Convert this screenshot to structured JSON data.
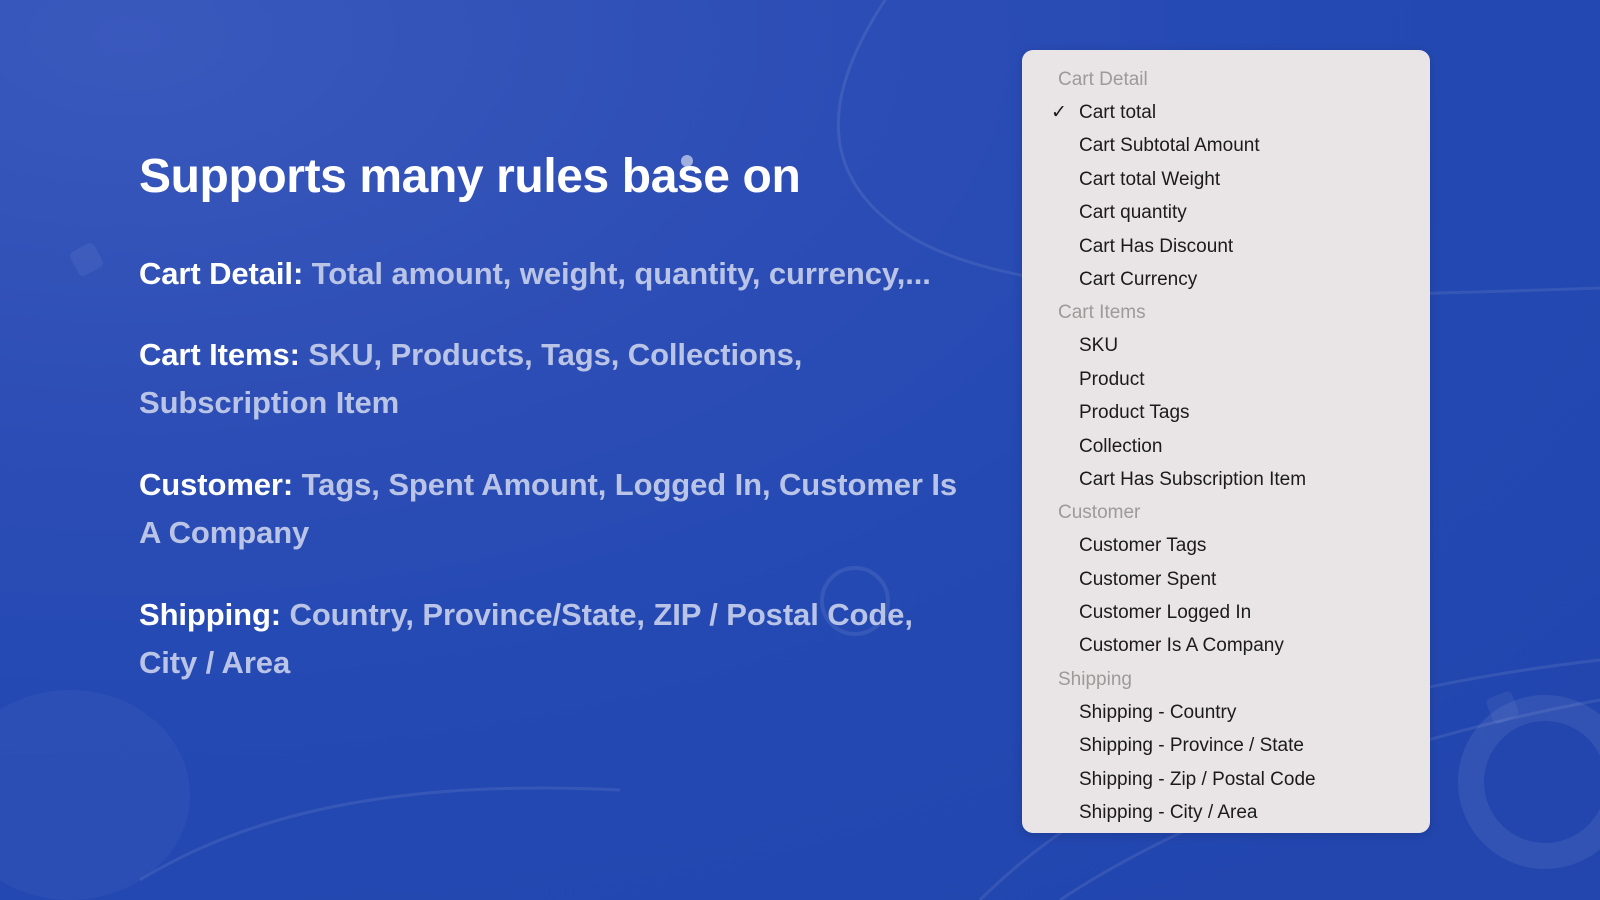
{
  "slide": {
    "headline": "Supports many rules base on",
    "paragraphs": [
      {
        "label": "Cart Detail:",
        "detail": " Total amount, weight, quantity, currency,..."
      },
      {
        "label": "Cart Items:",
        "detail": " SKU, Products, Tags, Collections, Subscription Item"
      },
      {
        "label": "Customer:",
        "detail": " Tags, Spent Amount, Logged In, Customer Is A Company"
      },
      {
        "label": "Shipping:",
        "detail": " Country, Province/State, ZIP / Postal Code, City / Area"
      }
    ]
  },
  "dropdown": {
    "selected_value": "Cart total",
    "check_glyph": "✓",
    "groups": [
      {
        "label": "Cart Detail",
        "options": [
          {
            "label": "Cart total",
            "selected": true
          },
          {
            "label": "Cart Subtotal Amount",
            "selected": false
          },
          {
            "label": "Cart total Weight",
            "selected": false
          },
          {
            "label": "Cart quantity",
            "selected": false
          },
          {
            "label": "Cart Has Discount",
            "selected": false
          },
          {
            "label": "Cart Currency",
            "selected": false
          }
        ]
      },
      {
        "label": "Cart Items",
        "options": [
          {
            "label": "SKU",
            "selected": false
          },
          {
            "label": "Product",
            "selected": false
          },
          {
            "label": "Product Tags",
            "selected": false
          },
          {
            "label": "Collection",
            "selected": false
          },
          {
            "label": "Cart Has Subscription Item",
            "selected": false
          }
        ]
      },
      {
        "label": "Customer",
        "options": [
          {
            "label": "Customer Tags",
            "selected": false
          },
          {
            "label": "Customer Spent",
            "selected": false
          },
          {
            "label": "Customer Logged In",
            "selected": false
          },
          {
            "label": "Customer Is A Company",
            "selected": false
          }
        ]
      },
      {
        "label": "Shipping",
        "options": [
          {
            "label": "Shipping - Country",
            "selected": false
          },
          {
            "label": "Shipping - Province / State",
            "selected": false
          },
          {
            "label": "Shipping - Zip / Postal Code",
            "selected": false
          },
          {
            "label": "Shipping - City / Area",
            "selected": false
          }
        ]
      }
    ]
  },
  "theme": {
    "background_blue": "#2449b3",
    "panel_background": "#e9e4e5",
    "headline_color": "#ffffff",
    "detail_text_color": "#b9c4e6",
    "option_text_color": "#1b1b1b",
    "group_label_color": "#9d9a9a"
  }
}
